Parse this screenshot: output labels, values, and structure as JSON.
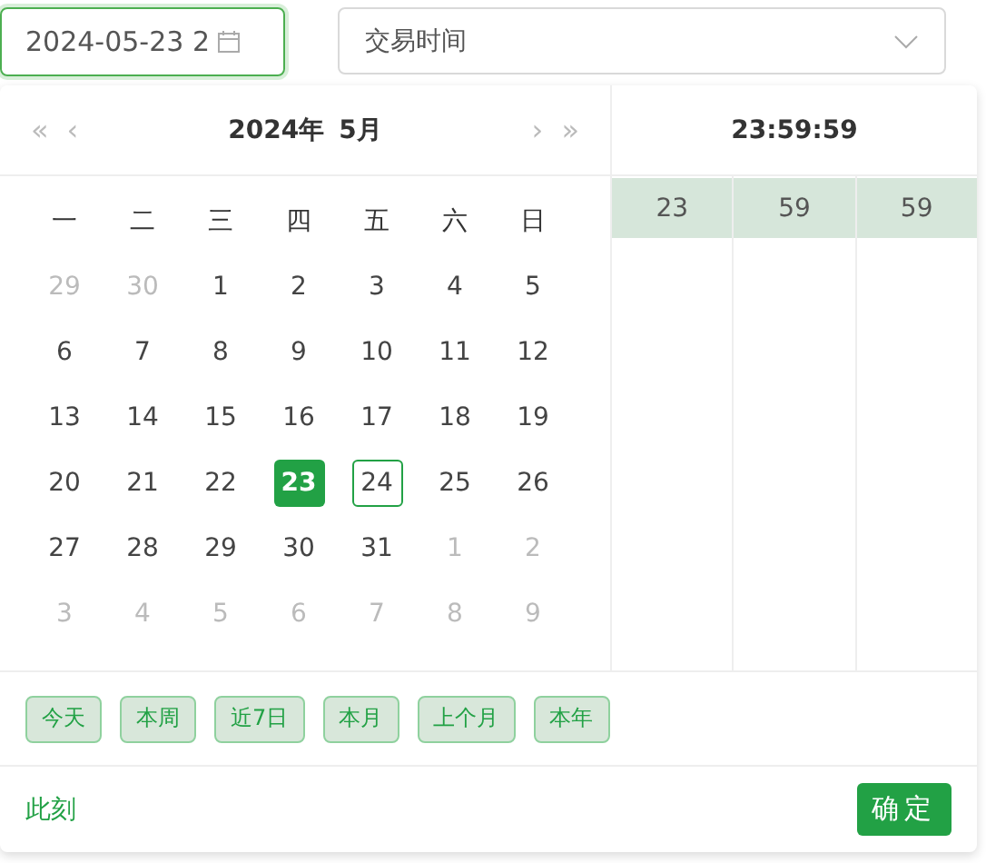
{
  "date_input": {
    "value": "2024-05-23 2"
  },
  "select": {
    "value": "交易时间"
  },
  "calendar": {
    "title_year": "2024年",
    "title_month": "5月",
    "prev_year": "«",
    "prev_month": "‹",
    "next_month": "›",
    "next_year": "»",
    "weekdays": [
      "一",
      "二",
      "三",
      "四",
      "五",
      "六",
      "日"
    ],
    "weeks": [
      [
        {
          "day": "29",
          "in_month": false,
          "selected": false,
          "today": false
        },
        {
          "day": "30",
          "in_month": false,
          "selected": false,
          "today": false
        },
        {
          "day": "1",
          "in_month": true,
          "selected": false,
          "today": false
        },
        {
          "day": "2",
          "in_month": true,
          "selected": false,
          "today": false
        },
        {
          "day": "3",
          "in_month": true,
          "selected": false,
          "today": false
        },
        {
          "day": "4",
          "in_month": true,
          "selected": false,
          "today": false
        },
        {
          "day": "5",
          "in_month": true,
          "selected": false,
          "today": false
        }
      ],
      [
        {
          "day": "6",
          "in_month": true,
          "selected": false,
          "today": false
        },
        {
          "day": "7",
          "in_month": true,
          "selected": false,
          "today": false
        },
        {
          "day": "8",
          "in_month": true,
          "selected": false,
          "today": false
        },
        {
          "day": "9",
          "in_month": true,
          "selected": false,
          "today": false
        },
        {
          "day": "10",
          "in_month": true,
          "selected": false,
          "today": false
        },
        {
          "day": "11",
          "in_month": true,
          "selected": false,
          "today": false
        },
        {
          "day": "12",
          "in_month": true,
          "selected": false,
          "today": false
        }
      ],
      [
        {
          "day": "13",
          "in_month": true,
          "selected": false,
          "today": false
        },
        {
          "day": "14",
          "in_month": true,
          "selected": false,
          "today": false
        },
        {
          "day": "15",
          "in_month": true,
          "selected": false,
          "today": false
        },
        {
          "day": "16",
          "in_month": true,
          "selected": false,
          "today": false
        },
        {
          "day": "17",
          "in_month": true,
          "selected": false,
          "today": false
        },
        {
          "day": "18",
          "in_month": true,
          "selected": false,
          "today": false
        },
        {
          "day": "19",
          "in_month": true,
          "selected": false,
          "today": false
        }
      ],
      [
        {
          "day": "20",
          "in_month": true,
          "selected": false,
          "today": false
        },
        {
          "day": "21",
          "in_month": true,
          "selected": false,
          "today": false
        },
        {
          "day": "22",
          "in_month": true,
          "selected": false,
          "today": false
        },
        {
          "day": "23",
          "in_month": true,
          "selected": true,
          "today": false
        },
        {
          "day": "24",
          "in_month": true,
          "selected": false,
          "today": true
        },
        {
          "day": "25",
          "in_month": true,
          "selected": false,
          "today": false
        },
        {
          "day": "26",
          "in_month": true,
          "selected": false,
          "today": false
        }
      ],
      [
        {
          "day": "27",
          "in_month": true,
          "selected": false,
          "today": false
        },
        {
          "day": "28",
          "in_month": true,
          "selected": false,
          "today": false
        },
        {
          "day": "29",
          "in_month": true,
          "selected": false,
          "today": false
        },
        {
          "day": "30",
          "in_month": true,
          "selected": false,
          "today": false
        },
        {
          "day": "31",
          "in_month": true,
          "selected": false,
          "today": false
        },
        {
          "day": "1",
          "in_month": false,
          "selected": false,
          "today": false
        },
        {
          "day": "2",
          "in_month": false,
          "selected": false,
          "today": false
        }
      ],
      [
        {
          "day": "3",
          "in_month": false,
          "selected": false,
          "today": false
        },
        {
          "day": "4",
          "in_month": false,
          "selected": false,
          "today": false
        },
        {
          "day": "5",
          "in_month": false,
          "selected": false,
          "today": false
        },
        {
          "day": "6",
          "in_month": false,
          "selected": false,
          "today": false
        },
        {
          "day": "7",
          "in_month": false,
          "selected": false,
          "today": false
        },
        {
          "day": "8",
          "in_month": false,
          "selected": false,
          "today": false
        },
        {
          "day": "9",
          "in_month": false,
          "selected": false,
          "today": false
        }
      ]
    ]
  },
  "time": {
    "title": "23:59:59",
    "columns": [
      [
        {
          "value": "23",
          "selected": true
        }
      ],
      [
        {
          "value": "59",
          "selected": true
        }
      ],
      [
        {
          "value": "59",
          "selected": true
        }
      ]
    ]
  },
  "presets": [
    "今天",
    "本周",
    "近7日",
    "本月",
    "上个月",
    "本年"
  ],
  "footer": {
    "now_link": "此刻",
    "ok_button": "确定"
  }
}
